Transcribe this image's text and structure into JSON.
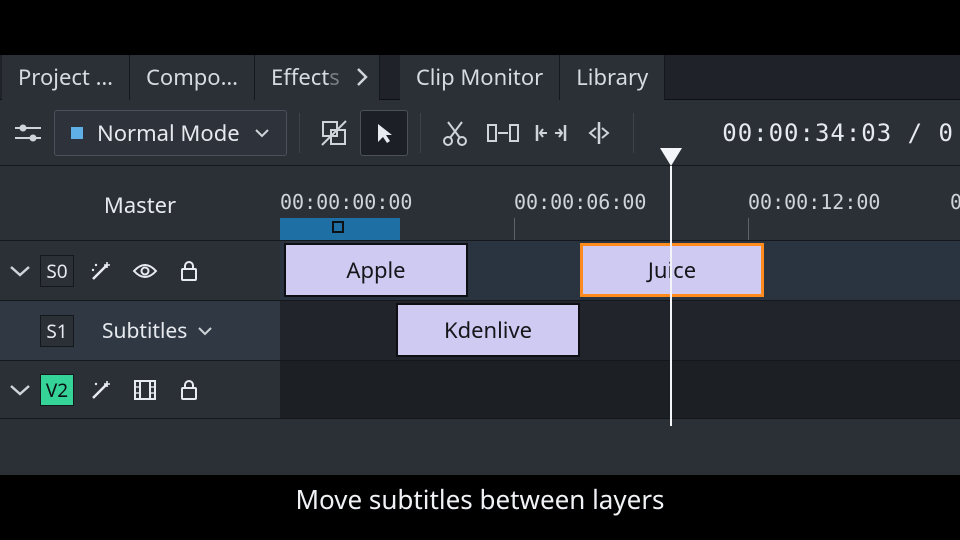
{
  "tabs": {
    "project": "Project …",
    "compo": "Compo…",
    "effects_prefix": "Effect",
    "clip_monitor": "Clip Monitor",
    "library": "Library"
  },
  "toolbar": {
    "mode_label": "Normal Mode",
    "timecode": "00:00:34:03  /  0"
  },
  "ruler": {
    "master_label": "Master",
    "t0": "00:00:00:00",
    "t1": "00:00:06:00",
    "t2": "00:00:12:00",
    "t3": "0"
  },
  "tracks": {
    "s0": "S0",
    "s1": "S1",
    "v2": "V2",
    "subtitles_label": "Subtitles"
  },
  "clips": {
    "apple": "Apple",
    "kdenlive": "Kdenlive",
    "juice": "Juice"
  },
  "caption": "Move subtitles between layers"
}
